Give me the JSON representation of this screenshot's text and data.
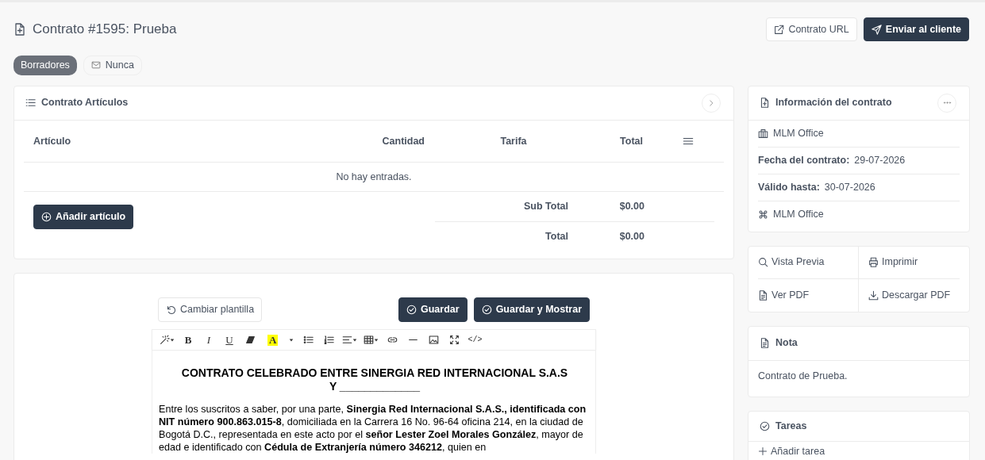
{
  "header": {
    "title": "Contrato #1595: Prueba",
    "buttons": [
      {
        "kind": "outline",
        "label": "Contrato URL"
      },
      {
        "kind": "primary",
        "label": "Enviar al cliente"
      }
    ]
  },
  "status": {
    "badge": "Borradores",
    "sent": "Nunca"
  },
  "items_card": {
    "title": "Contrato Artículos",
    "columns": [
      "Artículo",
      "Cantidad",
      "Tarifa",
      "Total"
    ],
    "empty": "No hay entradas.",
    "add_button": "Añadir artículo",
    "totals": [
      {
        "label": "Sub Total",
        "value": "$0.00"
      },
      {
        "label": "Total",
        "value": "$0.00"
      }
    ]
  },
  "editor": {
    "change_template": "Cambiar plantilla",
    "save": "Guardar",
    "save_show": "Guardar y Mostrar",
    "toolbar": [
      {
        "kind": "wand",
        "caret": true
      },
      {
        "kind": "bold",
        "label": "B",
        "caret": false
      },
      {
        "kind": "italic",
        "label": "I",
        "caret": false
      },
      {
        "kind": "underline",
        "label": "U",
        "caret": false
      },
      {
        "kind": "eraser",
        "caret": false
      },
      {
        "kind": "highlight",
        "label": "A",
        "caret": false
      },
      {
        "kind": "dropdown",
        "caret": true
      },
      {
        "kind": "ul",
        "caret": false
      },
      {
        "kind": "ol",
        "caret": false
      },
      {
        "kind": "align",
        "caret": true
      },
      {
        "kind": "table",
        "caret": true
      },
      {
        "kind": "link",
        "caret": false
      },
      {
        "kind": "hr",
        "caret": false
      },
      {
        "kind": "image",
        "caret": false
      },
      {
        "kind": "fullscreen",
        "caret": false
      },
      {
        "kind": "code",
        "label": "</>",
        "caret": false
      }
    ],
    "document": {
      "title_lines": [
        "CONTRATO CELEBRADO ENTRE SINERGIA RED INTERNACIONAL S.A.S",
        "Y _____________"
      ],
      "paragraph": "Entre los suscritos a saber, por una parte, **Sinergia Red Internacional S.A.S., identificada con NIT número 900.863.015-8**, domiciliada en la Carrera 16 No. 96-64 oficina 214, en la ciudad de Bogotá D.C., representada en este acto por el **señor Lester Zoel Morales González**, mayor de edad e identificado con **Cédula de Extranjería número 346212**, quien en"
    }
  },
  "info_card": {
    "title": "Información del contrato",
    "rows": [
      {
        "kind": "building",
        "text": "MLM Office"
      },
      {
        "kind": "field",
        "label": "Fecha del contrato:",
        "value": "29-07-2026"
      },
      {
        "kind": "field",
        "label": "Válido hasta:",
        "value": "30-07-2026"
      },
      {
        "kind": "command",
        "text": "MLM Office"
      }
    ]
  },
  "actions": [
    {
      "kind": "search",
      "label": "Vista Previa"
    },
    {
      "kind": "print",
      "label": "Imprimir"
    },
    {
      "kind": "file",
      "label": "Ver PDF"
    },
    {
      "kind": "download",
      "label": "Descargar PDF"
    }
  ],
  "note_card": {
    "title": "Nota",
    "text": "Contrato de Prueba."
  },
  "tasks_card": {
    "title": "Tareas",
    "add": "Añadir tarea"
  }
}
